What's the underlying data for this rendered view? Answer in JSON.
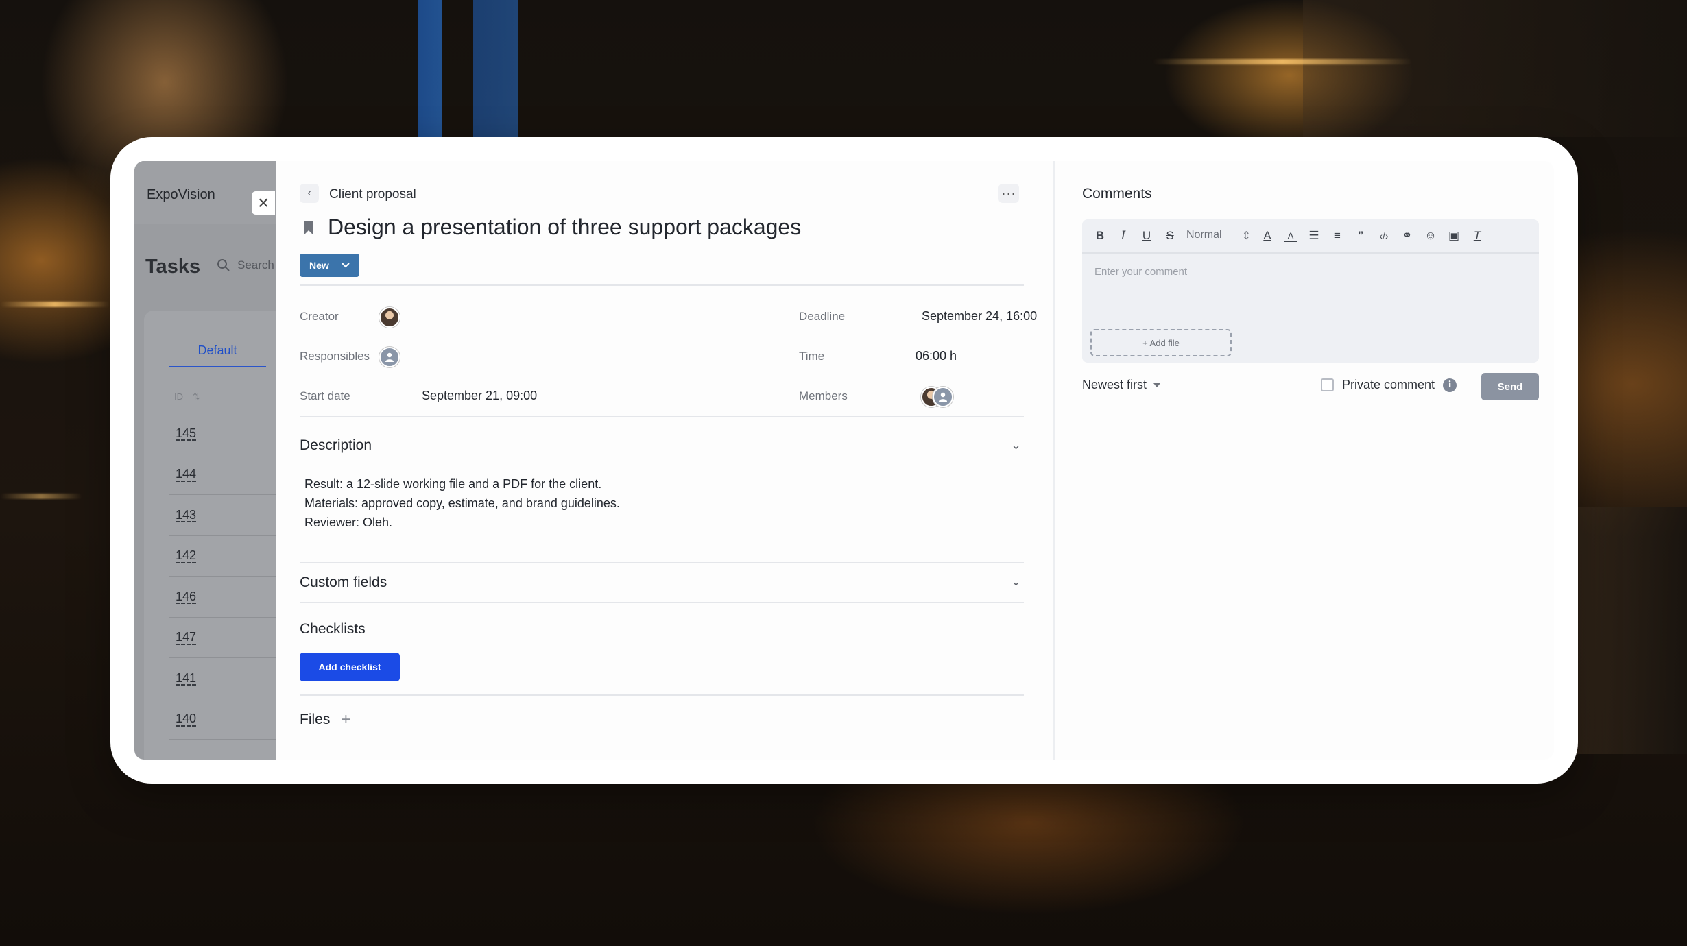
{
  "colors": {
    "primary_button": "#1b4be6",
    "status_button": "#3b74ab",
    "send_button_disabled": "#8b93a1"
  },
  "task_list": {
    "brand": "ExpoVision",
    "title": "Tasks",
    "search_placeholder": "Search",
    "tab": "Default",
    "columns": {
      "id": "ID",
      "sort_icon": "⇅"
    },
    "rows": [
      "145",
      "144",
      "143",
      "142",
      "146",
      "147",
      "141",
      "140"
    ]
  },
  "task": {
    "breadcrumb": "Client proposal",
    "title": "Design a presentation of three support packages",
    "status": "New",
    "fields": {
      "creator_label": "Creator",
      "responsibles_label": "Responsibles",
      "start_date_label": "Start date",
      "start_date_value": "September 21, 09:00",
      "deadline_label": "Deadline",
      "deadline_value": "September 24, 16:00",
      "time_label": "Time",
      "time_value": "06:00 h",
      "members_label": "Members"
    },
    "sections": {
      "description": "Description",
      "custom_fields": "Custom fields",
      "checklists": "Checklists",
      "files": "Files"
    },
    "description_lines": [
      "Result: a 12-slide working file and a PDF for the client.",
      "Materials: approved copy, estimate, and brand guidelines.",
      "Reviewer: Oleh."
    ],
    "add_checklist": "Add checklist"
  },
  "comments": {
    "title": "Comments",
    "text_style": "Normal",
    "placeholder": "Enter your comment",
    "add_file": "+ Add file",
    "sort": "Newest first",
    "private_label": "Private comment",
    "send": "Send"
  }
}
